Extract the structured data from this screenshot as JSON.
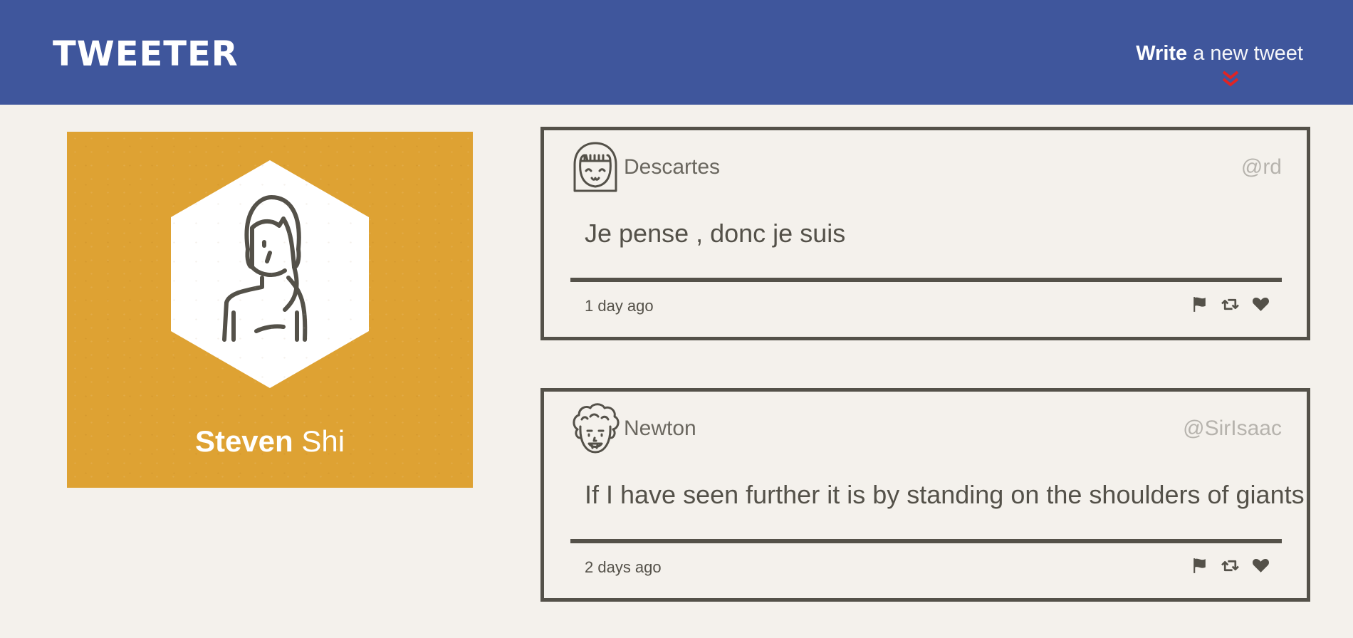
{
  "header": {
    "brand": "TWEETER",
    "compose_bold": "Write",
    "compose_rest": " a new tweet"
  },
  "profile": {
    "first_name": "Steven",
    "last_name": " Shi"
  },
  "tweets": [
    {
      "author": "Descartes",
      "handle": "@rd",
      "text": "Je pense , donc je suis",
      "time": "1 day ago"
    },
    {
      "author": "Newton",
      "handle": "@SirIsaac",
      "text": "If I have seen further it is by standing on the shoulders of giants",
      "time": "2 days ago"
    }
  ],
  "icons": {
    "compose": "chevron-double-down-icon",
    "flag": "flag-icon",
    "retweet": "retweet-icon",
    "like": "heart-icon"
  },
  "colors": {
    "header": "#3f569c",
    "profile_card": "#dea233",
    "page_background": "#f4f1ec",
    "ink": "#545149",
    "accent": "#e02424"
  }
}
